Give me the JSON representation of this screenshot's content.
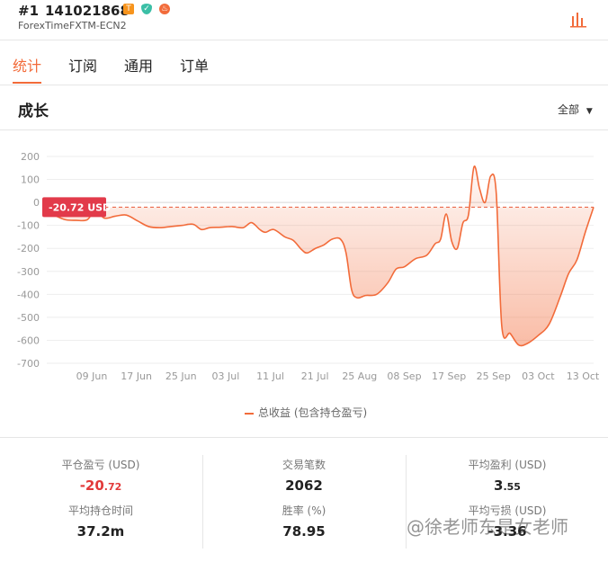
{
  "header": {
    "rank": "#1",
    "account_id": "141021868",
    "badges": [
      {
        "name": "tag-badge",
        "color": "#f7941d",
        "glyph": "T"
      },
      {
        "name": "verified-shield-icon",
        "color": "#3bbfa6",
        "glyph": "✓"
      },
      {
        "name": "fire-icon",
        "color": "#f26b3a",
        "glyph": "♨"
      }
    ],
    "server": "ForexTimeFXTM-ECN2"
  },
  "tabs": [
    {
      "label": "统计",
      "active": true
    },
    {
      "label": "订阅",
      "active": false
    },
    {
      "label": "通用",
      "active": false
    },
    {
      "label": "订单",
      "active": false
    }
  ],
  "growth": {
    "title": "成长",
    "range": "全部"
  },
  "chart_data": {
    "type": "area",
    "y_ticks": [
      "200",
      "100",
      "0",
      "-100",
      "-200",
      "-300",
      "-400",
      "-500",
      "-600",
      "-700"
    ],
    "ylim": [
      -700,
      200
    ],
    "x_tick_labels": [
      "09 Jun",
      "17 Jun",
      "25 Jun",
      "03 Jul",
      "11 Jul",
      "21 Jul",
      "25 Aug",
      "08 Sep",
      "17 Sep",
      "25 Sep",
      "03 Oct",
      "13 Oct"
    ],
    "current_label": "-20.72 USD",
    "current_value": -20.72,
    "series_name": "总收益 (包含持仓盈亏)",
    "color": "#f26b3a",
    "points": [
      [
        0,
        -55
      ],
      [
        0.4,
        -75
      ],
      [
        0.8,
        -78
      ],
      [
        1.2,
        -75
      ],
      [
        1.5,
        -30
      ],
      [
        1.8,
        -68
      ],
      [
        2.2,
        -60
      ],
      [
        2.6,
        -55
      ],
      [
        3.0,
        -80
      ],
      [
        3.4,
        -105
      ],
      [
        3.8,
        -110
      ],
      [
        4.2,
        -105
      ],
      [
        4.6,
        -100
      ],
      [
        5.0,
        -95
      ],
      [
        5.3,
        -118
      ],
      [
        5.6,
        -110
      ],
      [
        6.0,
        -108
      ],
      [
        6.4,
        -105
      ],
      [
        6.8,
        -110
      ],
      [
        7.1,
        -88
      ],
      [
        7.4,
        -118
      ],
      [
        7.6,
        -130
      ],
      [
        7.9,
        -118
      ],
      [
        8.3,
        -150
      ],
      [
        8.6,
        -165
      ],
      [
        8.9,
        -205
      ],
      [
        9.1,
        -220
      ],
      [
        9.4,
        -200
      ],
      [
        9.7,
        -185
      ],
      [
        10.0,
        -160
      ],
      [
        10.3,
        -160
      ],
      [
        10.5,
        -220
      ],
      [
        10.7,
        -380
      ],
      [
        10.9,
        -415
      ],
      [
        11.2,
        -405
      ],
      [
        11.6,
        -400
      ],
      [
        12.0,
        -350
      ],
      [
        12.3,
        -290
      ],
      [
        12.6,
        -280
      ],
      [
        13.0,
        -245
      ],
      [
        13.4,
        -230
      ],
      [
        13.7,
        -180
      ],
      [
        13.9,
        -160
      ],
      [
        14.1,
        -50
      ],
      [
        14.3,
        -170
      ],
      [
        14.5,
        -200
      ],
      [
        14.7,
        -90
      ],
      [
        14.9,
        -55
      ],
      [
        15.1,
        155
      ],
      [
        15.3,
        60
      ],
      [
        15.5,
        0
      ],
      [
        15.7,
        115
      ],
      [
        15.9,
        40
      ],
      [
        16.1,
        -540
      ],
      [
        16.4,
        -570
      ],
      [
        16.7,
        -620
      ],
      [
        17.0,
        -615
      ],
      [
        17.4,
        -580
      ],
      [
        17.8,
        -530
      ],
      [
        18.2,
        -410
      ],
      [
        18.5,
        -310
      ],
      [
        18.8,
        -250
      ],
      [
        19.1,
        -130
      ],
      [
        19.4,
        -20.72
      ]
    ]
  },
  "legend": {
    "label": "总收益 (包含持仓盈亏)"
  },
  "stats": [
    {
      "label": "平仓盈亏 (USD)",
      "value_int": "-20",
      "value_frac": ".72",
      "negative": true
    },
    {
      "label": "交易笔数",
      "value_int": "2062",
      "value_frac": "",
      "negative": false
    },
    {
      "label": "平均盈利 (USD)",
      "value_int": "3",
      "value_frac": ".55",
      "negative": false
    },
    {
      "label": "平均持仓时间",
      "value_int": "37.2m",
      "value_frac": "",
      "negative": false
    },
    {
      "label": "胜率 (%)",
      "value_int": "78.95",
      "value_frac": "",
      "negative": false
    },
    {
      "label": "平均亏损 (USD)",
      "value_int": "-3.36",
      "value_frac": "",
      "negative": false
    }
  ],
  "watermark": "@徐老师东是女老师"
}
